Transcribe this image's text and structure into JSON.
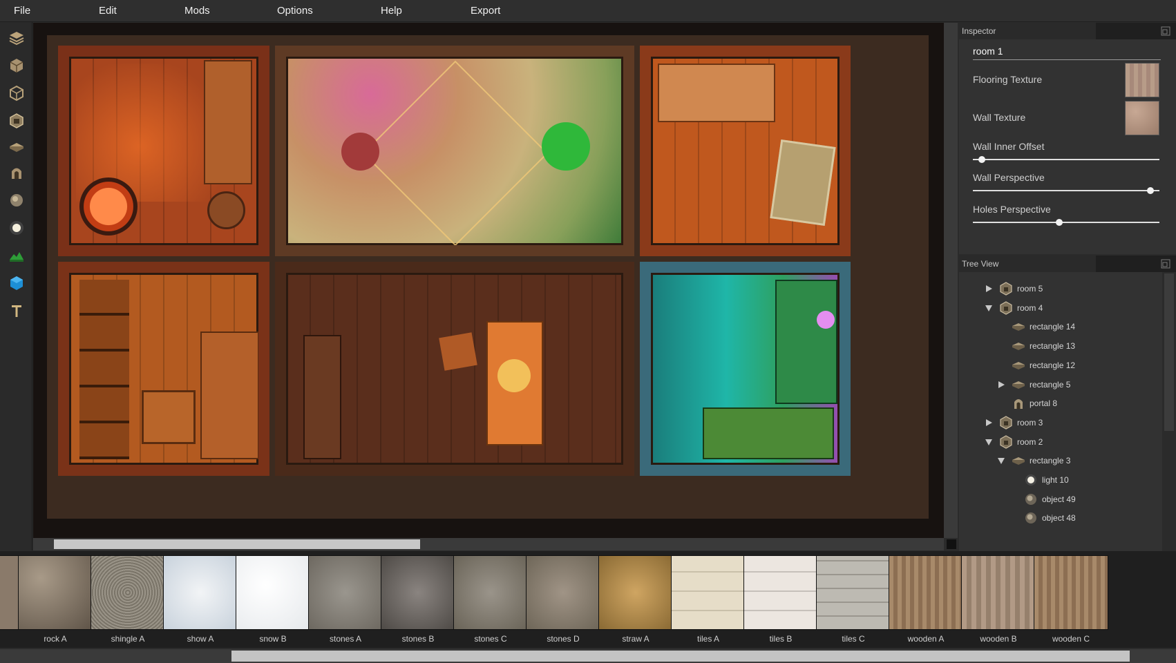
{
  "menu": [
    "File",
    "Edit",
    "Mods",
    "Options",
    "Help",
    "Export"
  ],
  "toolbar": {
    "tools": [
      "layers-icon",
      "box-icon",
      "box-outline-icon",
      "room-icon",
      "rectangle-icon",
      "portal-icon",
      "object-icon",
      "light-icon",
      "terrain-icon",
      "cube-icon",
      "text-icon"
    ]
  },
  "inspector": {
    "title": "Inspector",
    "name": "room 1",
    "flooring_label": "Flooring Texture",
    "wall_label": "Wall Texture",
    "wall_inner_offset_label": "Wall Inner Offset",
    "wall_inner_offset_value": 0.03,
    "wall_perspective_label": "Wall Perspective",
    "wall_perspective_value": 0.97,
    "holes_perspective_label": "Holes Perspective",
    "holes_perspective_value": 0.46
  },
  "tree": {
    "title": "Tree View",
    "items": [
      {
        "label": "room 5",
        "icon": "room-icon",
        "arrow": "collapsed"
      },
      {
        "label": "room 4",
        "icon": "room-icon",
        "arrow": "expanded"
      },
      {
        "label": "rectangle 14",
        "icon": "rectangle-icon",
        "arrow": "none"
      },
      {
        "label": "rectangle 13",
        "icon": "rectangle-icon",
        "arrow": "none"
      },
      {
        "label": "rectangle 12",
        "icon": "rectangle-icon",
        "arrow": "none"
      },
      {
        "label": "rectangle 5",
        "icon": "rectangle-icon",
        "arrow": "collapsed"
      },
      {
        "label": "portal 8",
        "icon": "portal-icon",
        "arrow": "none"
      },
      {
        "label": "room 3",
        "icon": "room-icon",
        "arrow": "collapsed"
      },
      {
        "label": "room 2",
        "icon": "room-icon",
        "arrow": "expanded"
      },
      {
        "label": "rectangle 3",
        "icon": "rectangle-icon",
        "arrow": "expanded"
      },
      {
        "label": "light 10",
        "icon": "light-icon",
        "arrow": "none"
      },
      {
        "label": "object 49",
        "icon": "object-icon",
        "arrow": "none"
      },
      {
        "label": "object 48",
        "icon": "object-icon",
        "arrow": "none"
      }
    ]
  },
  "textures": [
    "rock A",
    "shingle A",
    "show A",
    "snow B",
    "stones A",
    "stones B",
    "stones C",
    "stones D",
    "straw A",
    "tiles A",
    "tiles B",
    "tiles C",
    "wooden A",
    "wooden B",
    "wooden C"
  ],
  "colors": {
    "accent_light_red": "#e24a1a",
    "accent_light_pink": "#d34a8f",
    "accent_light_green": "#2fb83a",
    "accent_light_teal": "#18b8b0",
    "accent_light_magenta": "#c13ad6"
  }
}
